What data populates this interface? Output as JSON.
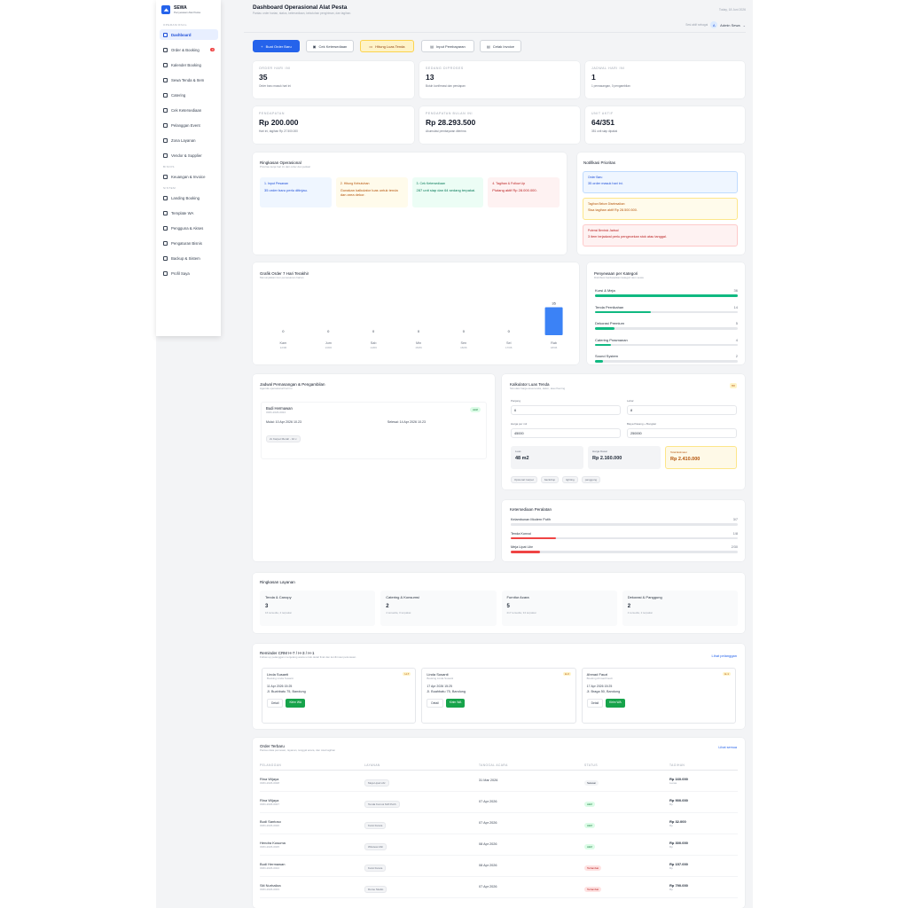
{
  "app": {
    "name": "SEWA",
    "tagline": "Penyewaan Alat Pesta"
  },
  "sidebar": {
    "section_ops": "Operasional",
    "section_fin": "Bisnis",
    "section_sys": "Sistem",
    "items": [
      {
        "label": "Dashboard",
        "icon": "grid-icon"
      },
      {
        "label": "Order & Booking",
        "icon": "cart-icon",
        "badge": "4"
      },
      {
        "label": "Kalender Booking",
        "icon": "calendar-icon"
      },
      {
        "label": "Sewa Tenda & Item",
        "icon": "tent-icon"
      },
      {
        "label": "Catering",
        "icon": "utensils-icon"
      },
      {
        "label": "Cek Ketersediaan",
        "icon": "check-icon"
      },
      {
        "label": "Pelanggan Event",
        "icon": "users-icon"
      },
      {
        "label": "Zona Layanan",
        "icon": "map-icon"
      },
      {
        "label": "Vendor & Supplier",
        "icon": "truck-icon"
      }
    ],
    "fin_items": [
      {
        "label": "Keuangan & Invoice",
        "icon": "wallet-icon"
      }
    ],
    "sys_items": [
      {
        "label": "Landing Booking",
        "icon": "globe-icon"
      },
      {
        "label": "Template WA",
        "icon": "chat-icon"
      },
      {
        "label": "Pengguna & Akses",
        "icon": "user-icon"
      },
      {
        "label": "Pengaturan Bisnis",
        "icon": "gear-icon"
      },
      {
        "label": "Backup & Sistem",
        "icon": "database-icon"
      },
      {
        "label": "Profil Saya",
        "icon": "profile-icon"
      }
    ]
  },
  "header": {
    "title": "Dashboard Operasional Alat Pesta",
    "subtitle": "Pantau order harian, status, ketersediaan, kebutuhan pengiriman, dan tagihan.",
    "date": "Today, 18 Juni 2026",
    "session": "Sesi aktif sebagai",
    "avatar": "A",
    "user": "Admin Sewa"
  },
  "actions": [
    {
      "label": "Buat Order Baru"
    },
    {
      "label": "Cek Ketersediaan"
    },
    {
      "label": "Hitung Luas Tenda"
    },
    {
      "label": "Input Pembayaran"
    },
    {
      "label": "Cetak Invoice"
    }
  ],
  "stats": [
    {
      "label": "Order Hari Ini",
      "value": "35",
      "sub": "Order baru masuk hari ini"
    },
    {
      "label": "Sedang Diproses",
      "value": "13",
      "sub": "Butuh konfirmasi dan persiapan"
    },
    {
      "label": "Jadwal Hari Ini",
      "value": "1",
      "sub": "1 pemasangan, 0 pengambilan"
    },
    {
      "label": "Pendapatan",
      "value": "Rp 200.000",
      "sub": "Hari ini, tagihan Rp 27.500.000"
    },
    {
      "label": "Pendapatan Bulan Ini",
      "value": "Rp 28.293.500",
      "sub": "Akumulasi pembayaran diterima"
    },
    {
      "label": "Unit Aktif",
      "value": "64/351",
      "sub": "351 unit siap dipakai"
    }
  ],
  "summary": {
    "title": "Ringkasan Operasional",
    "sub": "Prioritas kerja hari ini dari order dan jadwal",
    "boxes": [
      {
        "title": "1. Input Pesanan",
        "text": "35 order baru perlu ditinjau.",
        "color": "#1d4ed8",
        "bg": "#eff6ff"
      },
      {
        "title": "2. Hitung Kebutuhan",
        "text": "Gunakan kalkulator luas untuk tenda dan area dekor.",
        "color": "#b45309",
        "bg": "#fffbeb"
      },
      {
        "title": "3. Cek Ketersediaan",
        "text": "287 unit siap dan 64 sedang terpakai.",
        "color": "#047857",
        "bg": "#ecfdf5"
      },
      {
        "title": "4. Tagihan & Follow Up",
        "text": "Piutang aktif Rp 28.000.000.",
        "color": "#b91c1c",
        "bg": "#fef2f2"
      }
    ]
  },
  "notif": {
    "title": "Notifikasi Prioritas",
    "items": [
      {
        "title": "Order Baru",
        "text": "35 order masuk hari ini.",
        "color": "#1d4ed8",
        "bg": "#eff6ff",
        "border": "#bfdbfe"
      },
      {
        "title": "Tagihan Belum Diselesaikan",
        "text": "Sisa tagihan aktif Rp 28.500.500.",
        "color": "#b45309",
        "bg": "#fffbeb",
        "border": "#fde68a"
      },
      {
        "title": "Potensi Bentrok Jadwal",
        "text": "3 item terjadwal perlu pengecekan stok atau tanggal.",
        "color": "#b91c1c",
        "bg": "#fef2f2",
        "border": "#fecaca"
      }
    ]
  },
  "chart7": {
    "title": "Grafik Order 7 Hari Terakhir",
    "sub": "Menunjukkan tren pemesanan harian"
  },
  "chart_data": {
    "type": "bar",
    "title": "Grafik Order 7 Hari Terakhir",
    "categories": [
      "Kam",
      "Jum",
      "Sab",
      "Min",
      "Sen",
      "Sel",
      "Rab"
    ],
    "dates": [
      "12/06",
      "13/06",
      "14/06",
      "15/06",
      "16/06",
      "17/06",
      "18/06"
    ],
    "values": [
      0,
      0,
      0,
      0,
      0,
      0,
      35
    ],
    "ylim": [
      0,
      40
    ]
  },
  "category": {
    "title": "Penyewaan per Kategori",
    "sub": "Distribusi berdasarkan kategori item sewa",
    "items": [
      {
        "label": "Kursi & Meja",
        "value": 36,
        "color": "#10b981"
      },
      {
        "label": "Tenda Pernikahan",
        "value": 14,
        "color": "#10b981"
      },
      {
        "label": "Dekorasi Premium",
        "value": 5,
        "color": "#10b981"
      },
      {
        "label": "Catering Prasmanan",
        "value": 4,
        "color": "#10b981"
      },
      {
        "label": "Sound System",
        "value": 2,
        "color": "#10b981"
      }
    ],
    "max": 36
  },
  "schedule": {
    "title": "Jadwal Pemasangan & Pengambilan",
    "sub": "Agenda operasional hari ini",
    "name": "Budi Hermawan",
    "code": "ORD-2026-0024",
    "status": "Aktif",
    "start": "Mulai: 10 Apr 2026 10.23",
    "end": "Selesai: 14 Apr 2026 10.23",
    "tag": "2x Karpet Merah - 10 x"
  },
  "calc": {
    "title": "Kalkulator Luas Tenda",
    "sub": "Simulasi harga area tenda, dekor, atau flooring",
    "badge": "m²",
    "f_length": "Panjang",
    "v_length": "6",
    "f_width": "Lebar",
    "v_width": "8",
    "f_price": "Harga per m2",
    "v_price": "45000",
    "f_extra": "Biaya Pasang + Bongkar",
    "v_extra": "250000",
    "r_area_l": "Luas",
    "r_area": "48 m2",
    "r_base_l": "Harga Dasar",
    "r_base": "Rp 2.160.000",
    "r_total_l": "Total Estimasi",
    "r_total": "Rp 2.410.000",
    "tags": [
      "Opsional: karpet",
      "backdrop",
      "lighting",
      "panggung"
    ]
  },
  "avail": {
    "title": "Ketersediaan Peralatan",
    "items": [
      {
        "label": "Kelambunan Modern Putih",
        "value": "3/7",
        "pct": 0.43,
        "color": "#e5e7eb"
      },
      {
        "label": "Tenda Konvoi",
        "value": "1/8",
        "pct": 0.2,
        "color": "#ef4444"
      },
      {
        "label": "Meja Lipat Libr",
        "value": "2/30",
        "pct": 0.13,
        "color": "#ef4444"
      }
    ]
  },
  "services": {
    "title": "Ringkasan Layanan",
    "items": [
      {
        "name": "Tenda & Canopy",
        "value": "3",
        "sub": "16 tersedia, 4 terpakai"
      },
      {
        "name": "Catering & Konsumsi",
        "value": "2",
        "sub": "4 tersedia, 0 terpakai"
      },
      {
        "name": "Furnitur Acara",
        "value": "5",
        "sub": "217 tersedia, 34 terpakai"
      },
      {
        "name": "Dekorasi & Panggung",
        "value": "2",
        "sub": "4 tersedia, 2 terpakai"
      }
    ]
  },
  "crm": {
    "title": "Reminder CRM H-7 / H-3 / H-1",
    "sub": "Follow up pelanggan menjelang acara untuk detail final dan konfirmasi pelunasan",
    "link": "Lihat pelanggan",
    "cards": [
      {
        "name": "Linda Susanti",
        "type": "Booking Linda Susanti",
        "badge": "H-7",
        "date": "11 Apr 2026 15:25",
        "addr": "Jl. Buahbatu 75, Bandung",
        "detail": "Detail",
        "wa": "Kirim WA"
      },
      {
        "name": "Linda Susanti",
        "type": "Booking Linda Susanti",
        "badge": "H-3",
        "date": "17 Apr 2026 15:25",
        "addr": "Jl. Buahbatu 75, Bandung",
        "detail": "Detail",
        "wa": "Kirim WA"
      },
      {
        "name": "Ahmad Fauzi",
        "type": "Booking Ahmad Fauzi",
        "badge": "H-1",
        "date": "17 Apr 2026 15:25",
        "addr": "Jl. Braga 50, Bandung",
        "detail": "Detail",
        "wa": "Kirim WA"
      }
    ]
  },
  "orders": {
    "title": "Order Terbaru",
    "sub": "Pantau data pemesan, layanan, tanggal acara, dan total tagihan",
    "link": "Lihat semua",
    "cols": [
      "Pelanggan",
      "Layanan",
      "Tanggal Acara",
      "Status",
      "Tagihan"
    ],
    "rows": [
      {
        "name": "Rina Wijaya",
        "code": "ORD-2026-0028",
        "svc": "Meja Lipat Libr",
        "date": "31 Mar 2026",
        "status": "Selesai",
        "sbg": "#f3f4f6",
        "sfg": "#374151",
        "amt": "Rp 160.000",
        "note": "Lunas"
      },
      {
        "name": "Rina Wijaya",
        "code": "ORD-2026-0027",
        "svc": "Tenda Konvoi 6x8 Putih",
        "date": "07 Apr 2026",
        "status": "Aktif",
        "sbg": "#dcfce7",
        "sfg": "#15803d",
        "amt": "Rp 900.000",
        "note": "Dp"
      },
      {
        "name": "Budi Santoso",
        "code": "ORD-2026-0026",
        "svc": "Kursi Futura",
        "date": "07 Apr 2026",
        "status": "Aktif",
        "sbg": "#dcfce7",
        "sfg": "#15803d",
        "amt": "Rp 32.000",
        "note": "Dp"
      },
      {
        "name": "Hendra Kusuma",
        "code": "ORD-2026-0025",
        "svc": "Wireless Mic",
        "date": "08 Apr 2026",
        "status": "Aktif",
        "sbg": "#dcfce7",
        "sfg": "#15803d",
        "amt": "Rp 300.000",
        "note": "Dp"
      },
      {
        "name": "Budi Hermawan",
        "code": "ORD-2026-0024",
        "svc": "Kursi Futura",
        "date": "08 Apr 2026",
        "status": "Terlambat",
        "sbg": "#fee2e2",
        "sfg": "#b91c1c",
        "amt": "Rp 157.000",
        "note": "Dp"
      },
      {
        "name": "Siti Nurhaliza",
        "code": "ORD-2026-0023",
        "svc": "Dome Studio",
        "date": "07 Apr 2026",
        "status": "Terlambat",
        "sbg": "#fee2e2",
        "sfg": "#b91c1c",
        "amt": "Rp 790.000",
        "note": "Dp"
      }
    ]
  }
}
